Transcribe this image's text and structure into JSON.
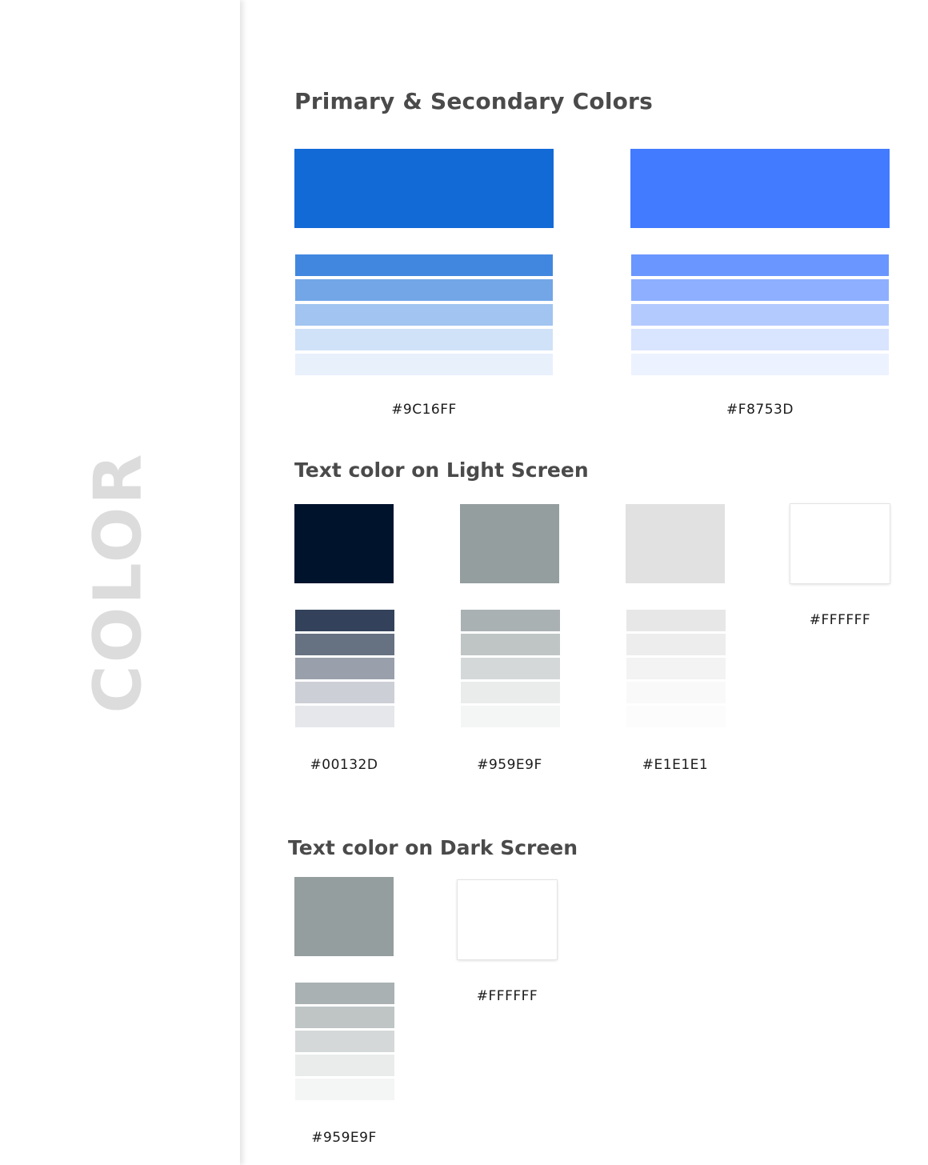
{
  "sidebar": {
    "title": "COLOR"
  },
  "sections": {
    "primary": {
      "title": "Primary & Secondary Colors",
      "swatches": [
        {
          "main": "#126AD7",
          "shades": [
            "#4287DF",
            "#72A6E7",
            "#A1C4F0",
            "#D0E2F7",
            "#E8F0FC"
          ],
          "label": "#9C16FF"
        },
        {
          "main": "#427BFF",
          "shades": [
            "#6A96FF",
            "#8EAFFF",
            "#B3CAFF",
            "#D9E4FF",
            "#ECF2FF"
          ],
          "label": "#F8753D"
        }
      ]
    },
    "light": {
      "title": "Text color on Light Screen",
      "swatches": [
        {
          "main": "#00132D",
          "shades": [
            "#33425A",
            "#667181",
            "#99A0AB",
            "#CCCFD5",
            "#E5E7EA"
          ],
          "label": "#00132D"
        },
        {
          "main": "#959E9F",
          "shades": [
            "#AAB1B2",
            "#BFC5C5",
            "#D5D8D9",
            "#EAECEC",
            "#F4F5F5"
          ],
          "label": "#959E9F"
        },
        {
          "main": "#E1E1E1",
          "shades": [
            "#E7E7E7",
            "#EDEDED",
            "#F3F3F3",
            "#F9F9F9",
            "#FCFCFC"
          ],
          "label": "#E1E1E1"
        },
        {
          "main": "#FFFFFF",
          "shades": [],
          "label": "#FFFFFF"
        }
      ]
    },
    "dark": {
      "title": "Text color on Dark Screen",
      "swatches": [
        {
          "main": "#959E9F",
          "shades": [
            "#AAB1B2",
            "#BFC5C5",
            "#D5D8D9",
            "#EAECEC",
            "#F4F5F5"
          ],
          "label": "#959E9F"
        },
        {
          "main": "#FFFFFF",
          "shades": [],
          "label": "#FFFFFF"
        }
      ]
    }
  }
}
